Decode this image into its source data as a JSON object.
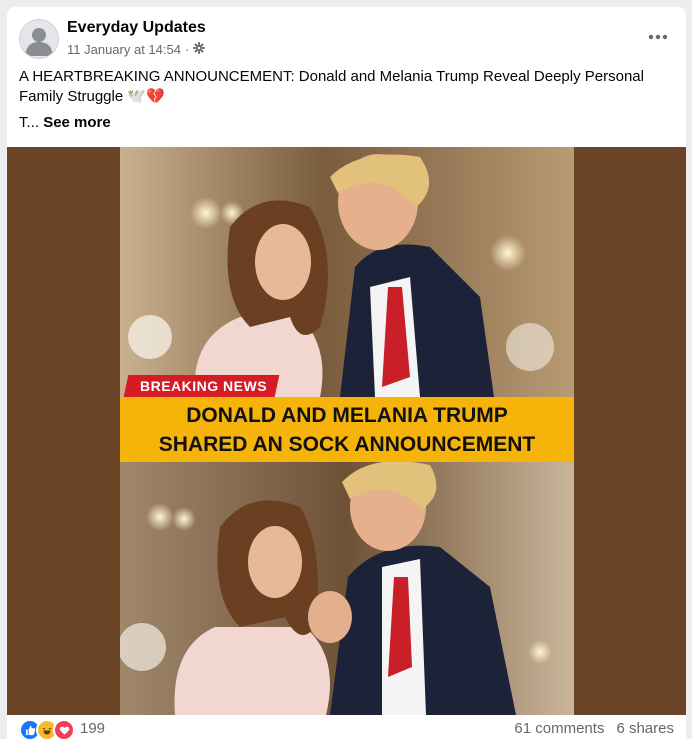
{
  "post": {
    "author": "Everyday Updates",
    "date": "11 January at 14:54",
    "separator": "·",
    "privacy_icon": "gear-icon",
    "more_icon": "more-options-icon",
    "text": "A HEARTBREAKING ANNOUNCEMENT: Donald and Melania Trump Reveal Deeply Personal Family Struggle 🕊️💔",
    "truncated_text": "T...",
    "see_more": "See more"
  },
  "image": {
    "background_color": "#6b4526",
    "tag": "BREAKING NEWS",
    "tag_color": "#d51c24",
    "headline_line1": "DONALD AND MELANIA TRUMP",
    "headline_line2": "SHARED AN SOCK ANNOUNCEMENT",
    "headline_color": "#f6b40b"
  },
  "stats": {
    "reaction_icons": [
      "like-icon",
      "haha-icon",
      "love-icon"
    ],
    "reactions": "199",
    "comments": "61 comments",
    "shares": "6 shares"
  },
  "colors": {
    "like": "#1877f2",
    "haha": "#f7b928",
    "love": "#f33e58"
  }
}
